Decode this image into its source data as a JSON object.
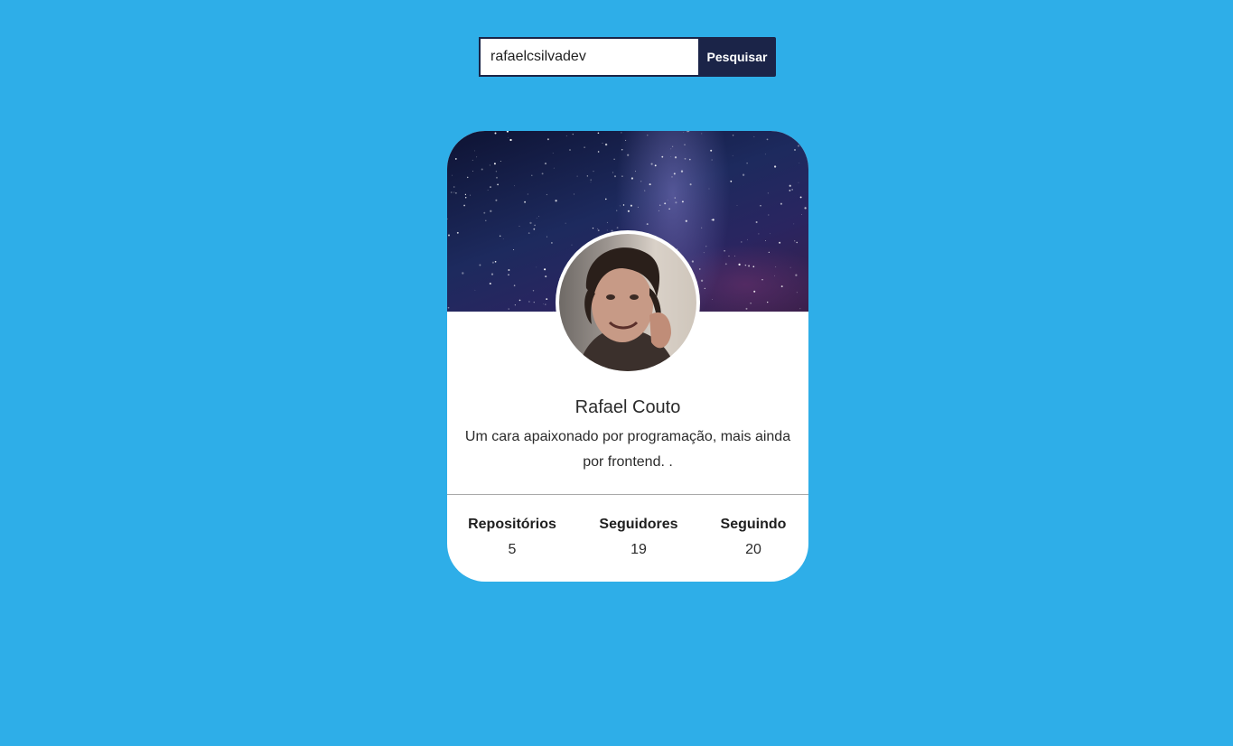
{
  "search": {
    "value": "rafaelcsilvadev",
    "button_label": "Pesquisar"
  },
  "profile": {
    "name": "Rafael Couto",
    "bio": "Um cara apaixonado por programação, mais ainda por frontend. .",
    "stats": {
      "repos_label": "Repositórios",
      "repos_value": "5",
      "followers_label": "Seguidores",
      "followers_value": "19",
      "following_label": "Seguindo",
      "following_value": "20"
    }
  },
  "colors": {
    "background": "#2eaee8",
    "button": "#1b2448",
    "card": "#ffffff",
    "divider": "#a9a9a9"
  },
  "icons": {
    "cover": "starry-sky-image",
    "avatar": "profile-photo"
  }
}
